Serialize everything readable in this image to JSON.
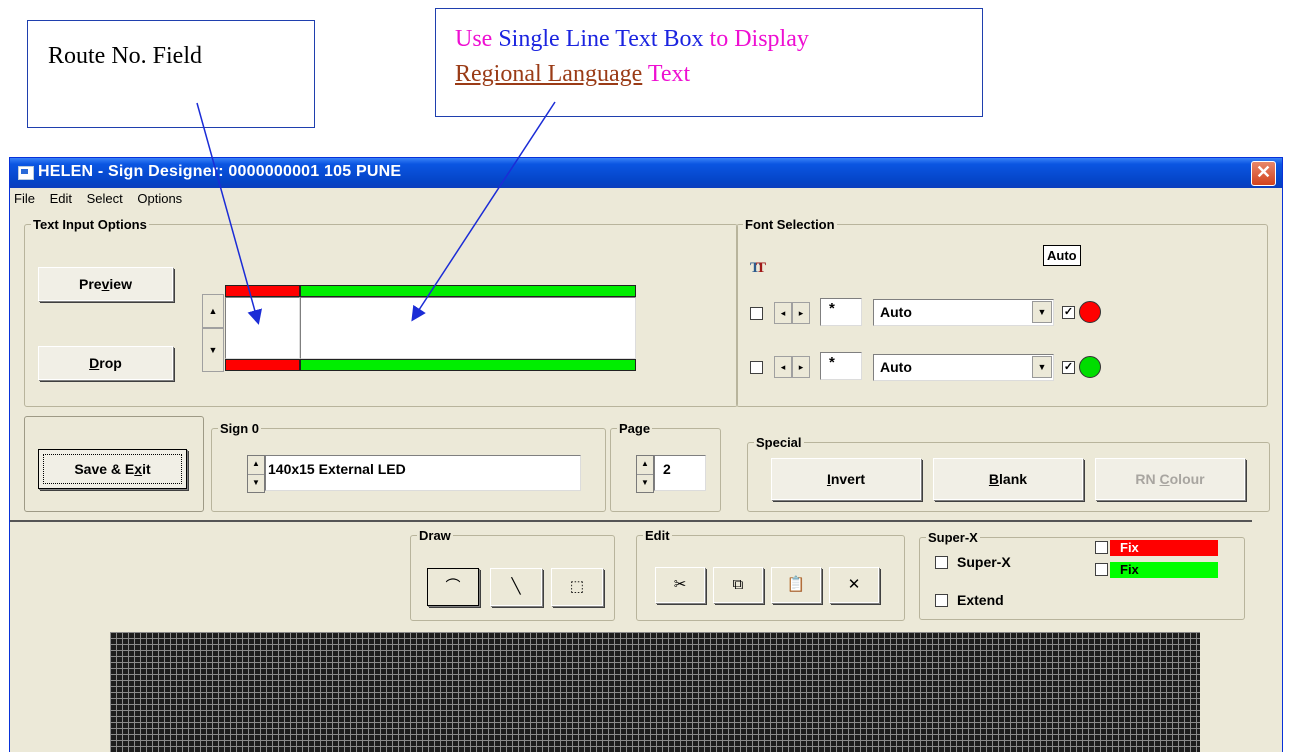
{
  "callouts": {
    "route": "Route No. Field",
    "regional_part1": "Use",
    "regional_part2": "Single Line Text Box",
    "regional_part3": "to Display",
    "regional_part4": "Regional Language",
    "regional_part5": "Text"
  },
  "window": {
    "title": "HELEN - Sign Designer: 0000000001 105 PUNE",
    "close": "✕"
  },
  "menu": [
    "File",
    "Edit",
    "Select",
    "Options"
  ],
  "text_input": {
    "legend": "Text Input Options",
    "preview_pre": "Pre",
    "preview_u": "v",
    "preview_post": "iew",
    "drop_u": "D",
    "drop_post": "rop",
    "route_value": "",
    "text_value": ""
  },
  "font_selection": {
    "legend": "Font Selection",
    "auto_badge": "Auto",
    "rows": [
      {
        "size": "*",
        "font": "Auto",
        "checked": true,
        "color": "#ff0000"
      },
      {
        "size": "*",
        "font": "Auto",
        "checked": true,
        "color": "#00dd00"
      }
    ]
  },
  "save_exit": {
    "pre": "Save & E",
    "u": "x",
    "post": "it"
  },
  "sign": {
    "legend": "Sign 0",
    "value": "140x15 External LED"
  },
  "page": {
    "legend": "Page",
    "value": "2"
  },
  "special": {
    "legend": "Special",
    "invert_u": "I",
    "invert_post": "nvert",
    "blank_u": "B",
    "blank_post": "lank",
    "rn_pre": "RN ",
    "rn_u": "C",
    "rn_post": "olour"
  },
  "draw": {
    "legend": "Draw"
  },
  "edit": {
    "legend": "Edit"
  },
  "superx": {
    "legend": "Super-X",
    "superx_label": "Super-X",
    "extend_label": "Extend",
    "fix1": "Fix",
    "fix2": "Fix",
    "fix1_color": "#ff0000",
    "fix2_color": "#00ff00"
  }
}
